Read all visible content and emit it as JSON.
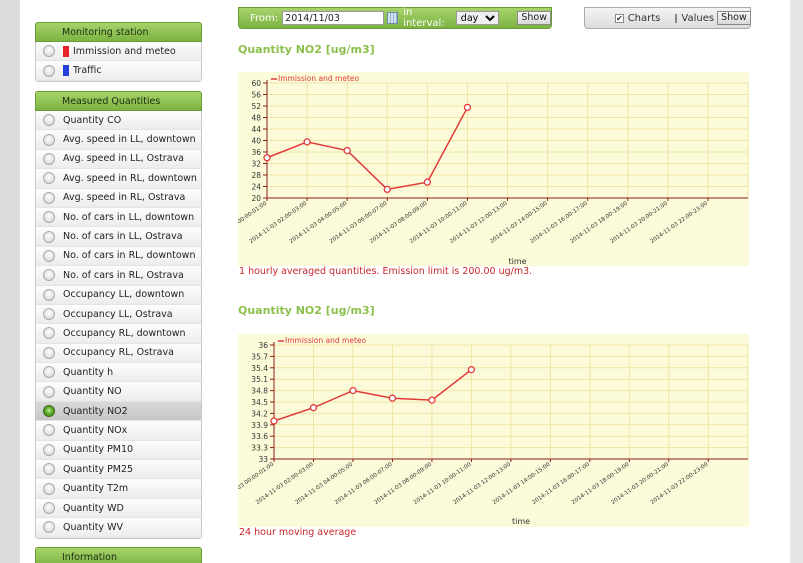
{
  "monitoring_station": {
    "title": "Monitoring station",
    "items": [
      {
        "label": "Immission and meteo",
        "color": "#e8232a"
      },
      {
        "label": "Traffic",
        "color": "#2540d8"
      }
    ]
  },
  "measured_quantities": {
    "title": "Measured Quantities",
    "selected_index": 16,
    "items": [
      {
        "label": "Quantity CO"
      },
      {
        "label": "Avg. speed in LL, downtown"
      },
      {
        "label": "Avg. speed in LL, Ostrava"
      },
      {
        "label": "Avg. speed in RL, downtown"
      },
      {
        "label": "Avg. speed in RL, Ostrava"
      },
      {
        "label": "No. of cars in LL, downtown"
      },
      {
        "label": "No. of cars in LL, Ostrava"
      },
      {
        "label": "No. of cars in RL, downtown"
      },
      {
        "label": "No. of cars in RL, Ostrava"
      },
      {
        "label": "Occupancy LL, downtown"
      },
      {
        "label": "Occupancy LL, Ostrava"
      },
      {
        "label": "Occupancy RL, downtown"
      },
      {
        "label": "Occupancy RL, Ostrava"
      },
      {
        "label": "Quantity h"
      },
      {
        "label": "Quantity NO"
      },
      {
        "label": "Quantity NO2"
      },
      {
        "label": "Quantity NOx"
      },
      {
        "label": "Quantity PM10"
      },
      {
        "label": "Quantity PM25"
      },
      {
        "label": "Quantity T2m"
      },
      {
        "label": "Quantity WD"
      },
      {
        "label": "Quantity WV"
      }
    ]
  },
  "information": {
    "title": "Information"
  },
  "date_form": {
    "from_label": "From:",
    "from_value": "2014/11/03",
    "interval_label": "in interval:",
    "interval_value": "day",
    "show_label": "Show"
  },
  "view_form": {
    "charts_label": "Charts",
    "charts_checked": true,
    "values_label": "Values",
    "values_checked": false,
    "show_label": "Show"
  },
  "colors": {
    "accent_green": "#8cc04c",
    "series_red": "#e03a3a",
    "note_red": "#c8272a",
    "chart_bg": "#fcfbd9"
  },
  "chart_data": [
    {
      "type": "line",
      "title": "Quantity NO2 [ug/m3]",
      "xlabel": "time",
      "ylabel": "",
      "ylim": [
        20,
        60
      ],
      "yticks": [
        20,
        24,
        28,
        32,
        36,
        40,
        44,
        48,
        52,
        56,
        60
      ],
      "ytick_labels": [
        "20",
        "24",
        "28",
        "32",
        "36",
        "40",
        "44",
        "48",
        "52",
        "56",
        "60"
      ],
      "categories": [
        "2014-11-03 00:00-01:00",
        "2014-11-03 02:00-03:00",
        "2014-11-03 04:00-05:00",
        "2014-11-03 06:00-07:00",
        "2014-11-03 08:00-09:00",
        "2014-11-03 10:00-11:00",
        "2014-11-03 12:00-13:00",
        "2014-11-03 14:00-15:00",
        "2014-11-03 16:00-17:00",
        "2014-11-03 18:00-19:00",
        "2014-11-03 20:00-21:00",
        "2014-11-03 22:00-23:00"
      ],
      "legend": "top-left",
      "grid": true,
      "series": [
        {
          "name": "Immission and meteo",
          "x": [
            0,
            1,
            2,
            3,
            4,
            5
          ],
          "values": [
            34,
            39.5,
            36.5,
            23,
            25.5,
            51.5
          ]
        }
      ],
      "note": "1 hourly averaged quantities. Emission limit is 200.00 ug/m3."
    },
    {
      "type": "line",
      "title": "Quantity NO2 [ug/m3]",
      "xlabel": "time",
      "ylabel": "",
      "ylim": [
        33,
        36
      ],
      "yticks": [
        33,
        33.3,
        33.6,
        33.9,
        34.2,
        34.5,
        34.8,
        35.1,
        35.4,
        35.7,
        36
      ],
      "ytick_labels": [
        "33",
        "33.3",
        "33.6",
        "33.9",
        "34.2",
        "34.5",
        "34.8",
        "35.1",
        "35.4",
        "35.7",
        "36"
      ],
      "categories": [
        "2014-11-03 00:00-01:00",
        "2014-11-03 02:00-03:00",
        "2014-11-03 04:00-05:00",
        "2014-11-03 06:00-07:00",
        "2014-11-03 08:00-09:00",
        "2014-11-03 10:00-11:00",
        "2014-11-03 12:00-13:00",
        "2014-11-03 14:00-15:00",
        "2014-11-03 16:00-17:00",
        "2014-11-03 18:00-19:00",
        "2014-11-03 20:00-21:00",
        "2014-11-03 22:00-23:00"
      ],
      "legend": "top-left",
      "grid": true,
      "series": [
        {
          "name": "Immission and meteo",
          "x": [
            0,
            1,
            2,
            3,
            4,
            5
          ],
          "values": [
            34.0,
            34.35,
            34.8,
            34.6,
            34.55,
            35.35
          ]
        }
      ],
      "note": "24 hour moving average"
    }
  ]
}
